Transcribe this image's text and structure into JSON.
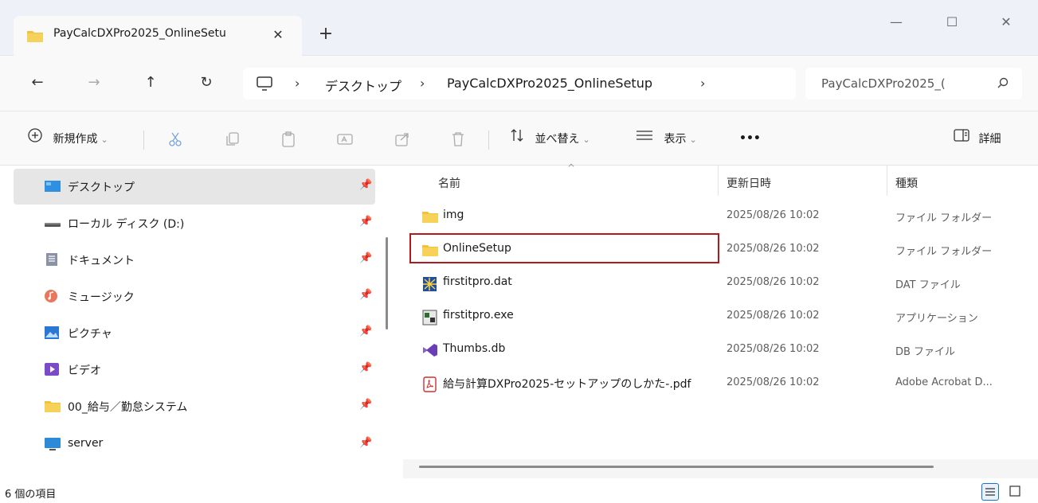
{
  "window": {
    "tab_title": "PayCalcDXPro2025_OnlineSetu",
    "tab_close": "✕",
    "new_tab": "+",
    "minimize": "—",
    "maximize": "☐",
    "close": "✕"
  },
  "address": {
    "back": "←",
    "forward": "→",
    "up": "↑",
    "refresh": "↻",
    "crumbs": [
      "デスクトップ",
      "PayCalcDXPro2025_OnlineSetup"
    ],
    "sep": "›",
    "search_text": "PayCalcDXPro2025_(",
    "search_icon": "search-icon"
  },
  "commandbar": {
    "new_label": "新規作成",
    "sort_label": "並べ替え",
    "view_label": "表示",
    "more_label": "•••",
    "details_label": "詳細",
    "chev": "⌄"
  },
  "sidebar": {
    "items": [
      {
        "label": "デスクトップ",
        "icon": "desktop-icon",
        "selected": true
      },
      {
        "label": "ローカル ディスク (D:)",
        "icon": "drive-icon"
      },
      {
        "label": "ドキュメント",
        "icon": "documents-icon"
      },
      {
        "label": "ミュージック",
        "icon": "music-icon"
      },
      {
        "label": "ピクチャ",
        "icon": "pictures-icon"
      },
      {
        "label": "ビデオ",
        "icon": "videos-icon"
      },
      {
        "label": "00_給与／勤怠システム",
        "icon": "folder-icon"
      },
      {
        "label": "server",
        "icon": "monitor-icon"
      }
    ],
    "pin": "📌"
  },
  "columns": {
    "name": "名前",
    "date": "更新日時",
    "type": "種類",
    "sort_indicator": "^"
  },
  "files": [
    {
      "name": "img",
      "date": "2025/08/26 10:02",
      "type": "ファイル フォルダー",
      "icon": "folder-icon"
    },
    {
      "name": "OnlineSetup",
      "date": "2025/08/26 10:02",
      "type": "ファイル フォルダー",
      "icon": "folder-icon"
    },
    {
      "name": "firstitpro.dat",
      "date": "2025/08/26 10:02",
      "type": "DAT ファイル",
      "icon": "dat-file-icon"
    },
    {
      "name": "firstitpro.exe",
      "date": "2025/08/26 10:02",
      "type": "アプリケーション",
      "icon": "exe-file-icon"
    },
    {
      "name": "Thumbs.db",
      "date": "2025/08/26 10:02",
      "type": "DB ファイル",
      "icon": "visualstudio-file-icon"
    },
    {
      "name": "給与計算DXPro2025-セットアップのしかた-.pdf",
      "date": "2025/08/26 10:02",
      "type": "Adobe Acrobat D...",
      "icon": "pdf-file-icon"
    }
  ],
  "status": {
    "item_count": "6 個の項目"
  },
  "colors": {
    "folder": "#f2c23d",
    "highlight": "#b11b1b",
    "accent": "#1a73c9"
  }
}
